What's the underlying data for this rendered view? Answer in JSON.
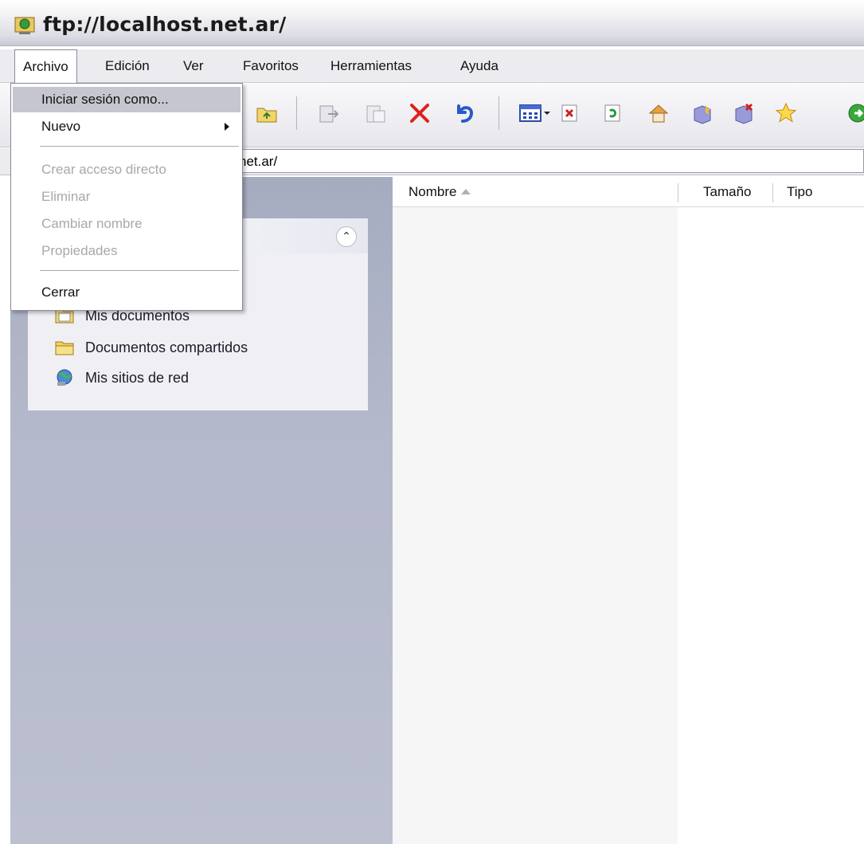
{
  "window": {
    "title": "ftp://localhost.net.ar/"
  },
  "menubar": {
    "items": [
      {
        "label": "Archivo"
      },
      {
        "label": "Edición"
      },
      {
        "label": "Ver"
      },
      {
        "label": "Favoritos"
      },
      {
        "label": "Herramientas"
      },
      {
        "label": "Ayuda"
      }
    ]
  },
  "archivo_menu": {
    "items": [
      {
        "label": "Iniciar sesión como..."
      },
      {
        "label": "Nuevo"
      },
      {
        "label": "Crear acceso directo"
      },
      {
        "label": "Eliminar"
      },
      {
        "label": "Cambiar nombre"
      },
      {
        "label": "Propiedades"
      },
      {
        "label": "Cerrar"
      }
    ]
  },
  "address": {
    "value": "net.ar/"
  },
  "task_pane": {
    "links": [
      {
        "label": "Mis documentos"
      },
      {
        "label": "Documentos compartidos"
      },
      {
        "label": "Mis sitios de red"
      }
    ]
  },
  "file_list": {
    "columns": [
      {
        "label": "Nombre"
      },
      {
        "label": "Tamaño"
      },
      {
        "label": "Tipo"
      }
    ]
  },
  "toolbar": {
    "icons": [
      "folder-up-icon",
      "move-to-icon",
      "copy-to-icon",
      "delete-icon",
      "undo-icon",
      "views-icon",
      "stop-icon",
      "refresh-icon",
      "home-icon",
      "favorites-add-icon",
      "favorites-remove-icon",
      "favorites-icon",
      "go-icon"
    ]
  }
}
